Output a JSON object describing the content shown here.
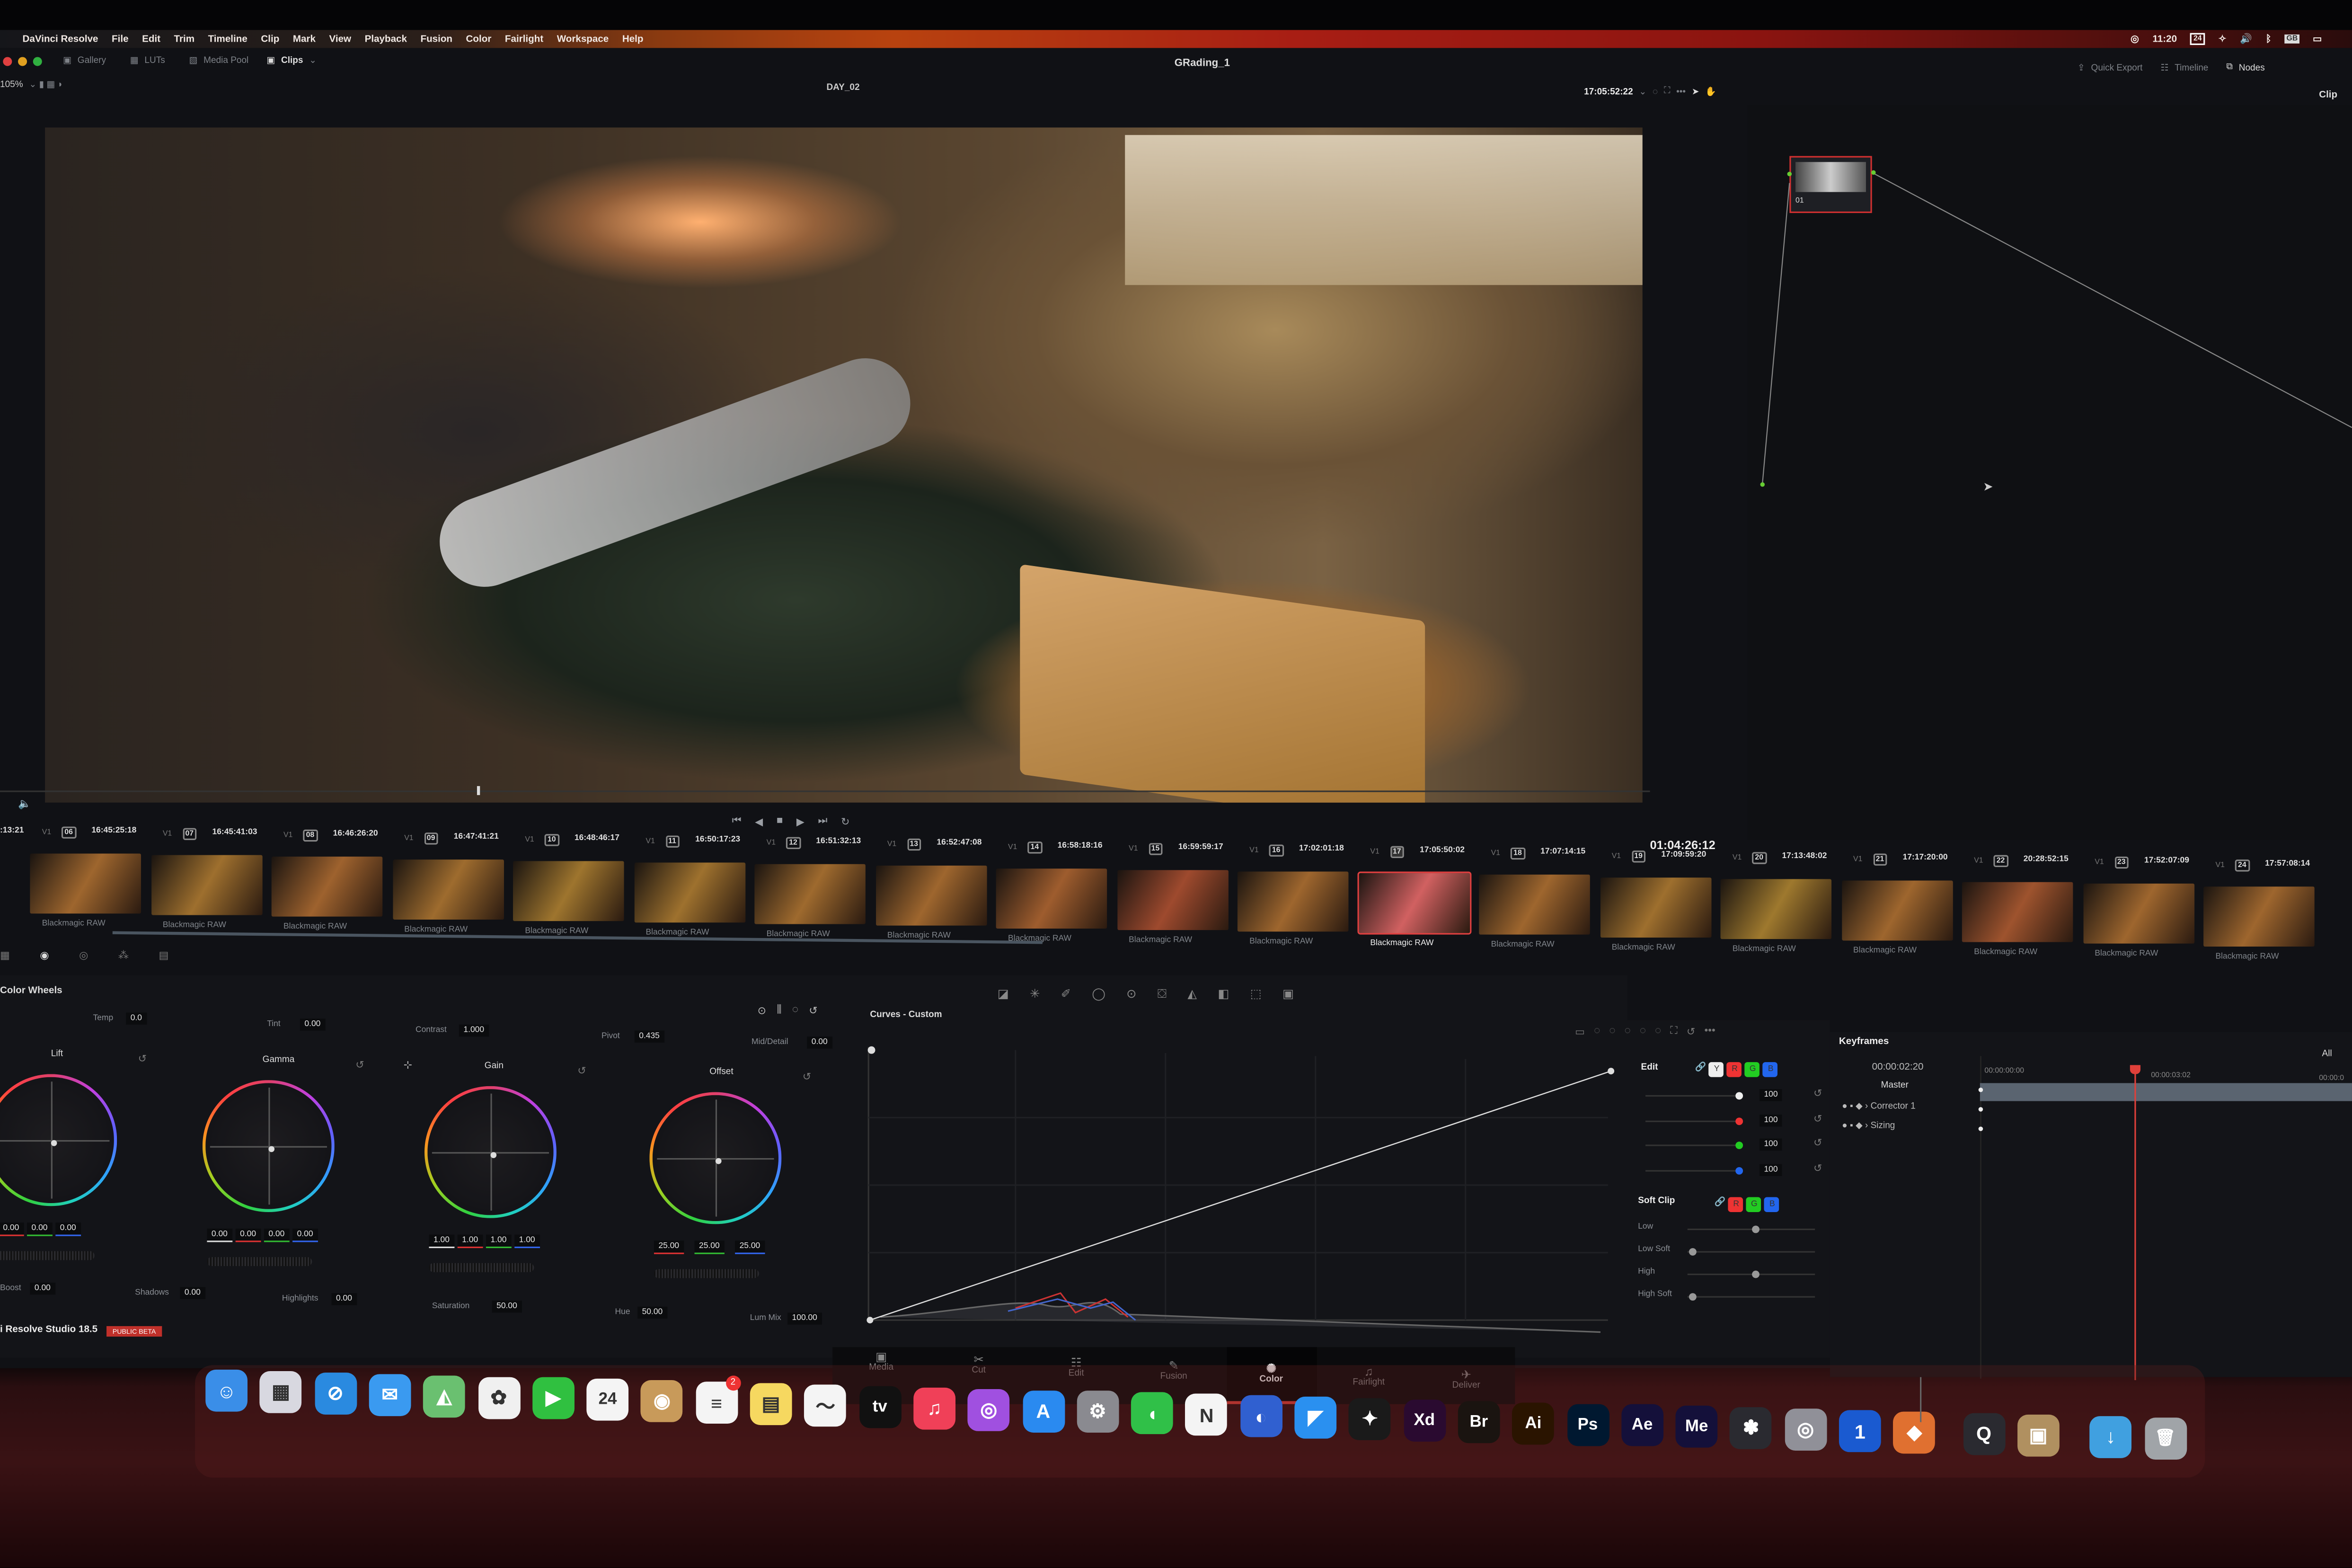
{
  "menubar": {
    "app": "DaVinci Resolve",
    "items": [
      "File",
      "Edit",
      "Trim",
      "Timeline",
      "Clip",
      "Mark",
      "View",
      "Playback",
      "Fusion",
      "Color",
      "Fairlight",
      "Workspace",
      "Help"
    ],
    "clock": "11:20",
    "calendar_day": "24",
    "keyboard": "GB"
  },
  "toolbar": {
    "gallery": "Gallery",
    "luts": "LUTs",
    "media_pool": "Media Pool",
    "clips": "Clips",
    "project_title": "GRading_1",
    "quick_export": "Quick Export",
    "timeline": "Timeline",
    "nodes": "Nodes"
  },
  "viewer_bar": {
    "zoom": "105%",
    "timeline_name": "DAY_02",
    "source_timecode": "17:05:52:22",
    "mode": "Clip"
  },
  "viewer": {
    "record_timecode": "01:04:26:12"
  },
  "node_graph": {
    "node_label": "01"
  },
  "clips": {
    "leading_tc": ":13:21",
    "items": [
      {
        "num": "06",
        "tc": "16:45:25:18",
        "track": "V1",
        "codec": "Blackmagic RAW"
      },
      {
        "num": "07",
        "tc": "16:45:41:03",
        "track": "V1",
        "codec": "Blackmagic RAW"
      },
      {
        "num": "08",
        "tc": "16:46:26:20",
        "track": "V1",
        "codec": "Blackmagic RAW"
      },
      {
        "num": "09",
        "tc": "16:47:41:21",
        "track": "V1",
        "codec": "Blackmagic RAW"
      },
      {
        "num": "10",
        "tc": "16:48:46:17",
        "track": "V1",
        "codec": "Blackmagic RAW"
      },
      {
        "num": "11",
        "tc": "16:50:17:23",
        "track": "V1",
        "codec": "Blackmagic RAW"
      },
      {
        "num": "12",
        "tc": "16:51:32:13",
        "track": "V1",
        "codec": "Blackmagic RAW"
      },
      {
        "num": "13",
        "tc": "16:52:47:08",
        "track": "V1",
        "codec": "Blackmagic RAW"
      },
      {
        "num": "14",
        "tc": "16:58:18:16",
        "track": "V1",
        "codec": "Blackmagic RAW"
      },
      {
        "num": "15",
        "tc": "16:59:59:17",
        "track": "V1",
        "codec": "Blackmagic RAW"
      },
      {
        "num": "16",
        "tc": "17:02:01:18",
        "track": "V1",
        "codec": "Blackmagic RAW"
      },
      {
        "num": "17",
        "tc": "17:05:50:02",
        "track": "V1",
        "codec": "Blackmagic RAW",
        "selected": true
      },
      {
        "num": "18",
        "tc": "17:07:14:15",
        "track": "V1",
        "codec": "Blackmagic RAW"
      },
      {
        "num": "19",
        "tc": "17:09:59:20",
        "track": "V1",
        "codec": "Blackmagic RAW"
      },
      {
        "num": "20",
        "tc": "17:13:48:02",
        "track": "V1",
        "codec": "Blackmagic RAW"
      },
      {
        "num": "21",
        "tc": "17:17:20:00",
        "track": "V1",
        "codec": "Blackmagic RAW"
      },
      {
        "num": "22",
        "tc": "20:28:52:15",
        "track": "V1",
        "codec": "Blackmagic RAW"
      },
      {
        "num": "23",
        "tc": "17:52:07:09",
        "track": "V1",
        "codec": "Blackmagic RAW"
      },
      {
        "num": "24",
        "tc": "17:57:08:14",
        "track": "V1",
        "codec": "Blackmagic RAW"
      }
    ]
  },
  "color_wheels": {
    "title": "Color Wheels",
    "top": {
      "temp_label": "Temp",
      "temp": "0.0",
      "tint_label": "Tint",
      "tint": "0.00",
      "contrast_label": "Contrast",
      "contrast": "1.000",
      "pivot_label": "Pivot",
      "pivot": "0.435",
      "mid_label": "Mid/Detail",
      "mid": "0.00"
    },
    "wheels": [
      {
        "name": "Lift",
        "values": [
          "0.00",
          "0.00",
          "0.00",
          "0.00"
        ]
      },
      {
        "name": "Gamma",
        "values": [
          "0.00",
          "0.00",
          "0.00",
          "0.00"
        ]
      },
      {
        "name": "Gain",
        "values": [
          "1.00",
          "1.00",
          "1.00",
          "1.00"
        ]
      },
      {
        "name": "Offset",
        "values": [
          "25.00",
          "25.00",
          "25.00"
        ]
      }
    ],
    "bottom": {
      "boost_label": "Boost",
      "boost": "0.00",
      "shadows_label": "Shadows",
      "shadows": "0.00",
      "highlights_label": "Highlights",
      "highlights": "0.00",
      "saturation_label": "Saturation",
      "saturation": "50.00",
      "hue_label": "Hue",
      "hue": "50.00",
      "lummix_label": "Lum Mix",
      "lummix": "100.00"
    }
  },
  "curves": {
    "title": "Curves - Custom"
  },
  "edit": {
    "label": "Edit",
    "channels": [
      "Y",
      "R",
      "G",
      "B"
    ],
    "values": [
      "100",
      "100",
      "100",
      "100"
    ],
    "soft_clip": "Soft Clip",
    "soft_rows": [
      "Low",
      "Low Soft",
      "High",
      "High Soft"
    ]
  },
  "keyframes": {
    "title": "Keyframes",
    "filter": "All",
    "current": "00:00:02:20",
    "ruler": [
      "00:00:00:00",
      "00:00:03:02",
      "00:00:0"
    ],
    "tracks": [
      "Master",
      "Corrector 1",
      "Sizing"
    ]
  },
  "footer": {
    "version": "i Resolve Studio 18.5",
    "badge": "PUBLIC BETA"
  },
  "pages": [
    {
      "label": "Media"
    },
    {
      "label": "Cut"
    },
    {
      "label": "Edit"
    },
    {
      "label": "Fusion"
    },
    {
      "label": "Color",
      "active": true
    },
    {
      "label": "Fairlight"
    },
    {
      "label": "Deliver"
    }
  ],
  "colors": {
    "accent": "#e0403a",
    "menubar": "#b8420f"
  },
  "dock": [
    {
      "name": "finder",
      "c": "#3a8ee8",
      "g": "☺"
    },
    {
      "name": "launchpad",
      "c": "#d8d8e0",
      "g": "▦"
    },
    {
      "name": "safari",
      "c": "#2a8ae0",
      "g": "⊘"
    },
    {
      "name": "mail",
      "c": "#3a9af0",
      "g": "✉"
    },
    {
      "name": "maps",
      "c": "#6ac070",
      "g": "◭"
    },
    {
      "name": "photos",
      "c": "#f0f0f0",
      "g": "✿"
    },
    {
      "name": "facetime",
      "c": "#30c040",
      "g": "▶"
    },
    {
      "name": "calendar",
      "c": "#f4f4f4",
      "g": "24"
    },
    {
      "name": "contacts",
      "c": "#c89a5a",
      "g": "◉"
    },
    {
      "name": "reminders",
      "c": "#f4f4f4",
      "g": "≡",
      "badge": "2"
    },
    {
      "name": "notes",
      "c": "#f6d860",
      "g": "▤"
    },
    {
      "name": "freeform",
      "c": "#f4f4f4",
      "g": "〜"
    },
    {
      "name": "tv",
      "c": "#111",
      "g": "tv"
    },
    {
      "name": "music",
      "c": "#f04058",
      "g": "♫"
    },
    {
      "name": "podcasts",
      "c": "#a050e0",
      "g": "◎"
    },
    {
      "name": "app-store",
      "c": "#2a8af0",
      "g": "A"
    },
    {
      "name": "system-settings",
      "c": "#8a8a90",
      "g": "⚙"
    },
    {
      "name": "messages",
      "c": "#30c048",
      "g": "◖"
    },
    {
      "name": "notion",
      "c": "#f4f4f4",
      "g": "N"
    },
    {
      "name": "app",
      "c": "#3060d0",
      "g": "◐"
    },
    {
      "name": "framer",
      "c": "#2a90f0",
      "g": "◤"
    },
    {
      "name": "figma",
      "c": "#1a1a1a",
      "g": "✦"
    },
    {
      "name": "xd",
      "c": "#2a0a30",
      "g": "Xd"
    },
    {
      "name": "bridge",
      "c": "#1a1410",
      "g": "Br"
    },
    {
      "name": "illustrator",
      "c": "#2a1400",
      "g": "Ai"
    },
    {
      "name": "photoshop",
      "c": "#001830",
      "g": "Ps"
    },
    {
      "name": "after-effects",
      "c": "#14103a",
      "g": "Ae"
    },
    {
      "name": "media-encoder",
      "c": "#14103a",
      "g": "Me"
    },
    {
      "name": "davinci-resolve",
      "c": "#2a2a30",
      "g": "✽"
    },
    {
      "name": "app2",
      "c": "#909098",
      "g": "◎"
    },
    {
      "name": "1password",
      "c": "#1a5ad0",
      "g": "1"
    },
    {
      "name": "firefox-dev",
      "c": "#e07030",
      "g": "◆"
    },
    {
      "name": "quicktime",
      "c": "#2a2a30",
      "g": "Q"
    },
    {
      "name": "archive-utility",
      "c": "#b09060",
      "g": "▣"
    },
    {
      "name": "downloads",
      "c": "#40a0e0",
      "g": "↓"
    },
    {
      "name": "trash",
      "c": "#a0a4a8",
      "g": "🗑"
    }
  ]
}
